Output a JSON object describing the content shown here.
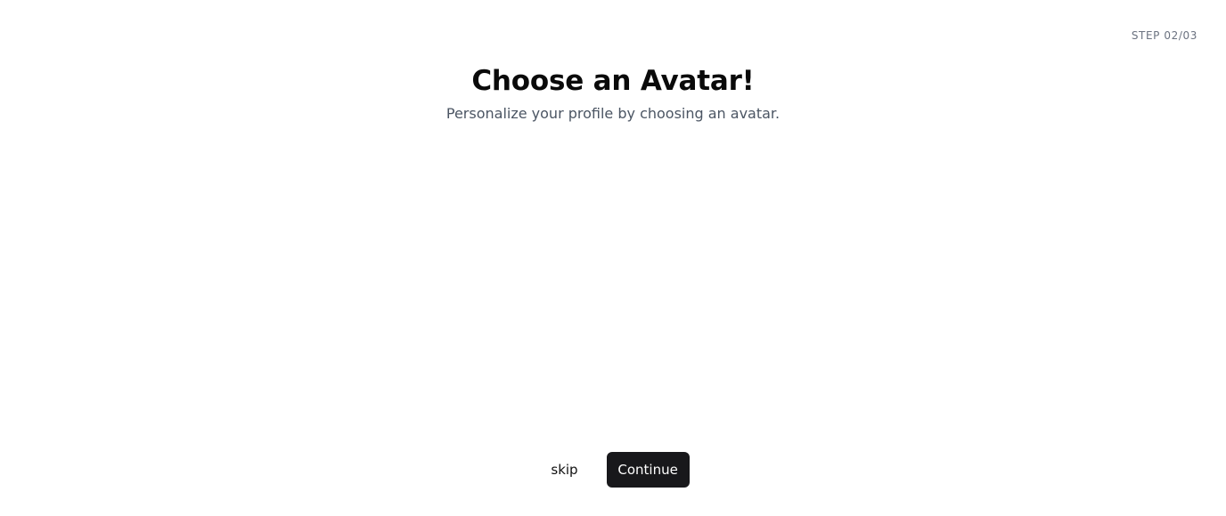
{
  "step": {
    "indicator": "STEP 02/03"
  },
  "header": {
    "title": "Choose an Avatar!",
    "subtitle": "Personalize your profile by choosing an avatar."
  },
  "actions": {
    "skip_label": "skip",
    "continue_label": "Continue"
  },
  "colors": {
    "background": "#ffffff",
    "primary_button": "#18181b",
    "subtitle_text": "#4b5563",
    "step_text": "#6b7280"
  }
}
